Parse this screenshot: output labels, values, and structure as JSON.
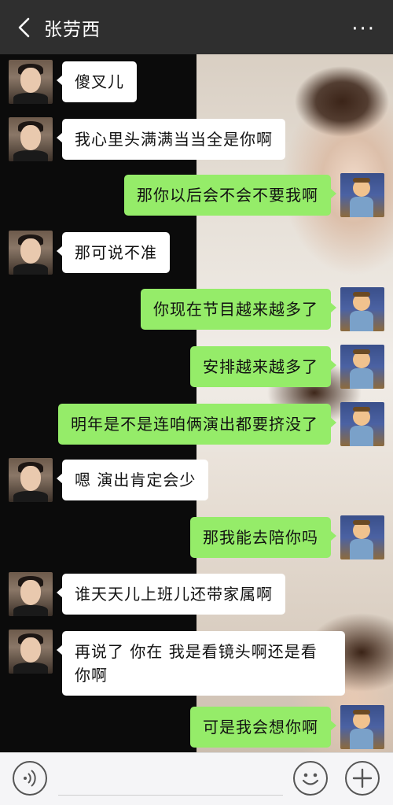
{
  "header": {
    "title": "张劳西",
    "more_glyph": "···"
  },
  "messages": [
    {
      "side": "left",
      "text": "傻叉儿"
    },
    {
      "side": "left",
      "text": "我心里头满满当当全是你啊"
    },
    {
      "side": "right",
      "text": "那你以后会不会不要我啊"
    },
    {
      "side": "left",
      "text": "那可说不准"
    },
    {
      "side": "right",
      "text": "你现在节目越来越多了"
    },
    {
      "side": "right",
      "text": "安排越来越多了"
    },
    {
      "side": "right",
      "text": "明年是不是连咱俩演出都要挤没了"
    },
    {
      "side": "left",
      "text": "嗯 演出肯定会少"
    },
    {
      "side": "right",
      "text": "那我能去陪你吗"
    },
    {
      "side": "left",
      "text": "谁天天儿上班儿还带家属啊"
    },
    {
      "side": "left",
      "text": "再说了 你在 我是看镜头啊还是看你啊"
    },
    {
      "side": "right",
      "text": "可是我会想你啊"
    }
  ],
  "icons": {
    "back": "chevron-left-icon",
    "more": "more-dots-icon",
    "voice": "voice-icon",
    "emoji": "emoji-icon",
    "plus": "plus-icon"
  },
  "colors": {
    "topbar": "#2f2f2f",
    "bubble_self": "#95ec69",
    "bubble_other": "#ffffff",
    "input_bar": "#f5f5f7"
  }
}
